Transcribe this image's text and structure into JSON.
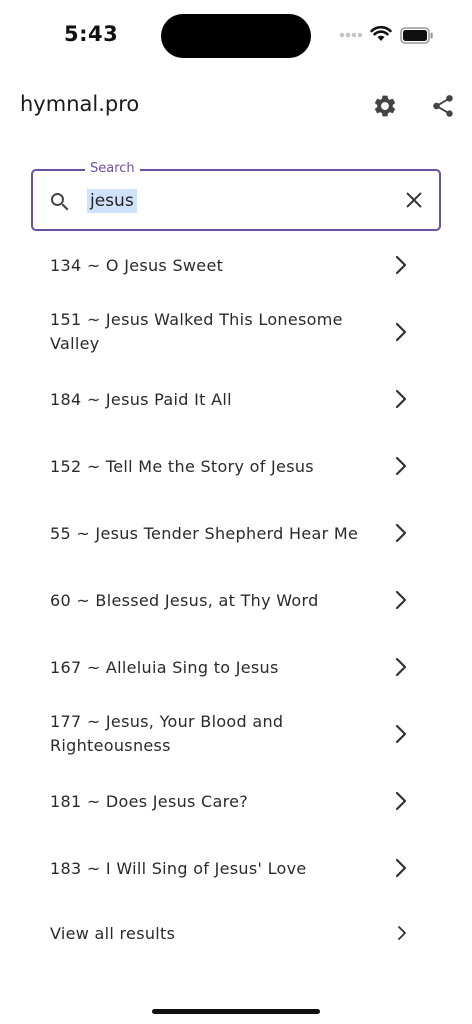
{
  "status_bar": {
    "time": "5:43"
  },
  "header": {
    "title": "hymnal.pro",
    "settings_icon": "gear-icon",
    "share_icon": "share-icon"
  },
  "search": {
    "label": "Search",
    "value": "jesus",
    "accent_color": "#6a4fa8",
    "highlight_color": "#cfe2fb"
  },
  "results": [
    {
      "label": "134 ~ O Jesus Sweet"
    },
    {
      "label": "151 ~ Jesus Walked This Lonesome Valley"
    },
    {
      "label": "184 ~ Jesus Paid It All"
    },
    {
      "label": "152 ~ Tell Me the Story of Jesus"
    },
    {
      "label": "55 ~ Jesus Tender Shepherd Hear Me"
    },
    {
      "label": "60 ~ Blessed Jesus, at Thy Word"
    },
    {
      "label": "167 ~ Alleluia Sing to Jesus"
    },
    {
      "label": "177 ~ Jesus, Your Blood and Righteousness"
    },
    {
      "label": "181 ~ Does Jesus Care?"
    },
    {
      "label": "183 ~ I Will Sing of Jesus' Love"
    }
  ],
  "view_all": {
    "label": "View all results"
  }
}
